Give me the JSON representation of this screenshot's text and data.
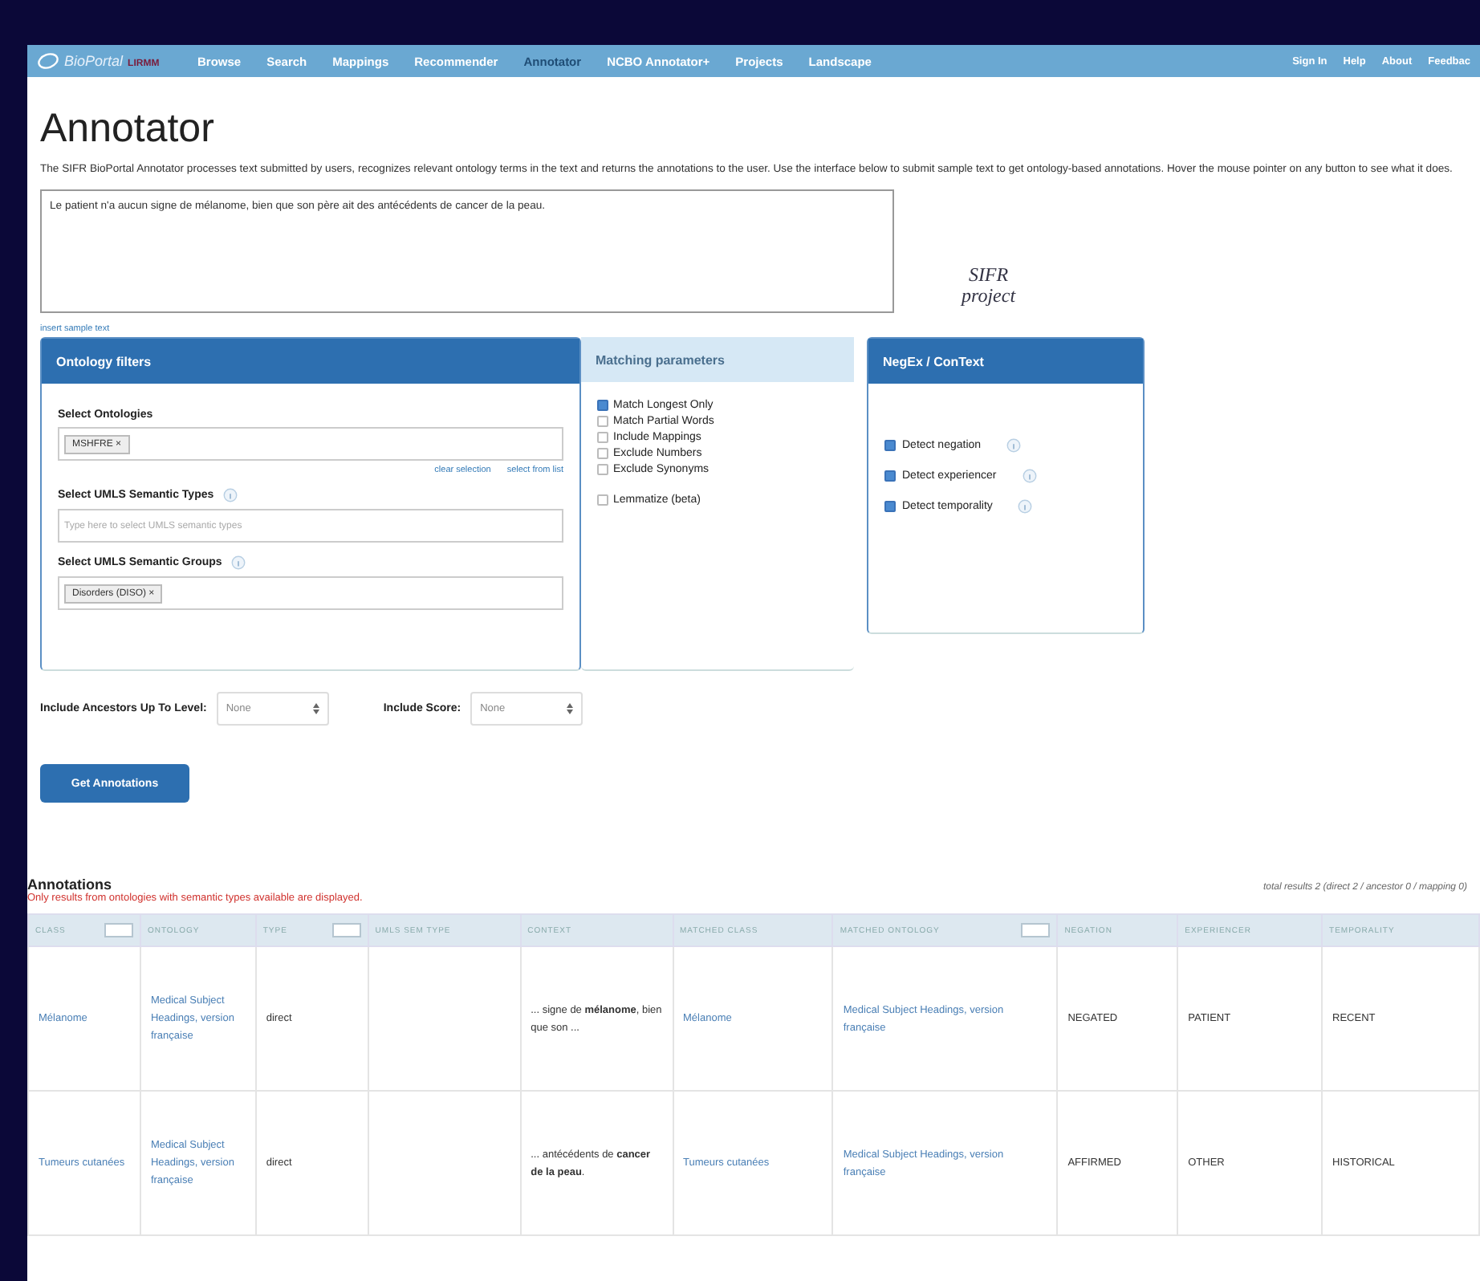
{
  "nav": {
    "logo_main": "BioPortal",
    "logo_sub": "LIRMM",
    "items": [
      {
        "label": "Browse",
        "selected": false
      },
      {
        "label": "Search",
        "selected": false
      },
      {
        "label": "Mappings",
        "selected": false
      },
      {
        "label": "Recommender",
        "selected": false
      },
      {
        "label": "Annotator",
        "selected": true
      },
      {
        "label": "NCBO Annotator+",
        "selected": false
      },
      {
        "label": "Projects",
        "selected": false
      },
      {
        "label": "Landscape",
        "selected": false
      }
    ],
    "right_items": [
      "Sign In",
      "Help",
      "About",
      "Feedbac"
    ]
  },
  "title": "Annotator",
  "description": "The SIFR BioPortal Annotator processes text submitted by users, recognizes relevant ontology terms in the text and returns the annotations to the user. Use the interface below to submit sample text to get ontology-based annotations. Hover the mouse pointer on any button to see what it does.",
  "input_text": "Le patient n'a aucun signe de mélanome, bien que son père ait des antécédents de cancer de la peau.",
  "project_logo": [
    "SIFR",
    "project"
  ],
  "insert_sample": "insert sample text",
  "ontology_filters": {
    "title": "Ontology filters",
    "fields": [
      {
        "label": "Select Ontologies",
        "info": false,
        "chips": [
          "MSHFRE ×"
        ],
        "links": [
          "clear selection",
          "select from list"
        ]
      },
      {
        "label": "Select UMLS Semantic Types",
        "info": true,
        "placeholder": "Type here to select UMLS semantic types"
      },
      {
        "label": "Select UMLS Semantic Groups",
        "info": true,
        "chips": [
          "Disorders (DISO) ×"
        ]
      }
    ]
  },
  "matching": {
    "title": "Matching parameters",
    "groups": [
      {
        "options": [
          {
            "label": "Match Longest Only",
            "checked": true
          },
          {
            "label": "Match Partial Words",
            "checked": false
          },
          {
            "label": "Include Mappings",
            "checked": false
          },
          {
            "label": "Exclude Numbers",
            "checked": false
          },
          {
            "label": "Exclude Synonyms",
            "checked": false
          }
        ]
      },
      {
        "options": [
          {
            "label": "Lemmatize (beta)",
            "checked": false
          }
        ]
      }
    ]
  },
  "negex": {
    "title": "NegEx / ConText",
    "options": [
      {
        "label": "Detect negation",
        "checked": true
      },
      {
        "label": "Detect experiencer",
        "checked": true
      },
      {
        "label": "Detect temporality",
        "checked": true
      }
    ]
  },
  "selects": [
    {
      "label": "Include Ancestors Up To Level:",
      "value": "None"
    },
    {
      "label": "Include Score:",
      "value": "None"
    }
  ],
  "submit": "Get Annotations",
  "results": {
    "title": "Annotations",
    "note": "Only results from ontologies with semantic types available are displayed.",
    "summary": "total results 2 (direct 2 / ancestor 0 / mapping 0)",
    "columns": [
      {
        "label": "CLASS",
        "filter": true
      },
      {
        "label": "ONTOLOGY",
        "filter": false
      },
      {
        "label": "TYPE",
        "filter": true
      },
      {
        "label": "UMLS SEM TYPE",
        "filter": false
      },
      {
        "label": "CONTEXT",
        "filter": false
      },
      {
        "label": "MATCHED CLASS",
        "filter": false
      },
      {
        "label": "MATCHED ONTOLOGY",
        "filter": true
      },
      {
        "label": "NEGATION",
        "filter": false
      },
      {
        "label": "EXPERIENCER",
        "filter": false
      },
      {
        "label": "TEMPORALITY",
        "filter": false
      }
    ],
    "rows": [
      {
        "class": "Mélanome",
        "ontology": "Medical Subject Headings, version française",
        "type": "direct",
        "context": "... signe de **mélanome**, bien que son ...",
        "matched_class": "Mélanome",
        "matched_ontology": "Medical Subject Headings, version française",
        "negation": "NEGATED",
        "experiencer": "PATIENT",
        "temporality": "RECENT"
      },
      {
        "class": "Tumeurs cutanées",
        "ontology": "Medical Subject Headings, version française",
        "type": "direct",
        "context": "... antécédents de **cancer de la peau**.",
        "matched_class": "Tumeurs cutanées",
        "matched_ontology": "Medical Subject Headings, version française",
        "negation": "AFFIRMED",
        "experiencer": "OTHER",
        "temporality": "HISTORICAL"
      }
    ]
  }
}
